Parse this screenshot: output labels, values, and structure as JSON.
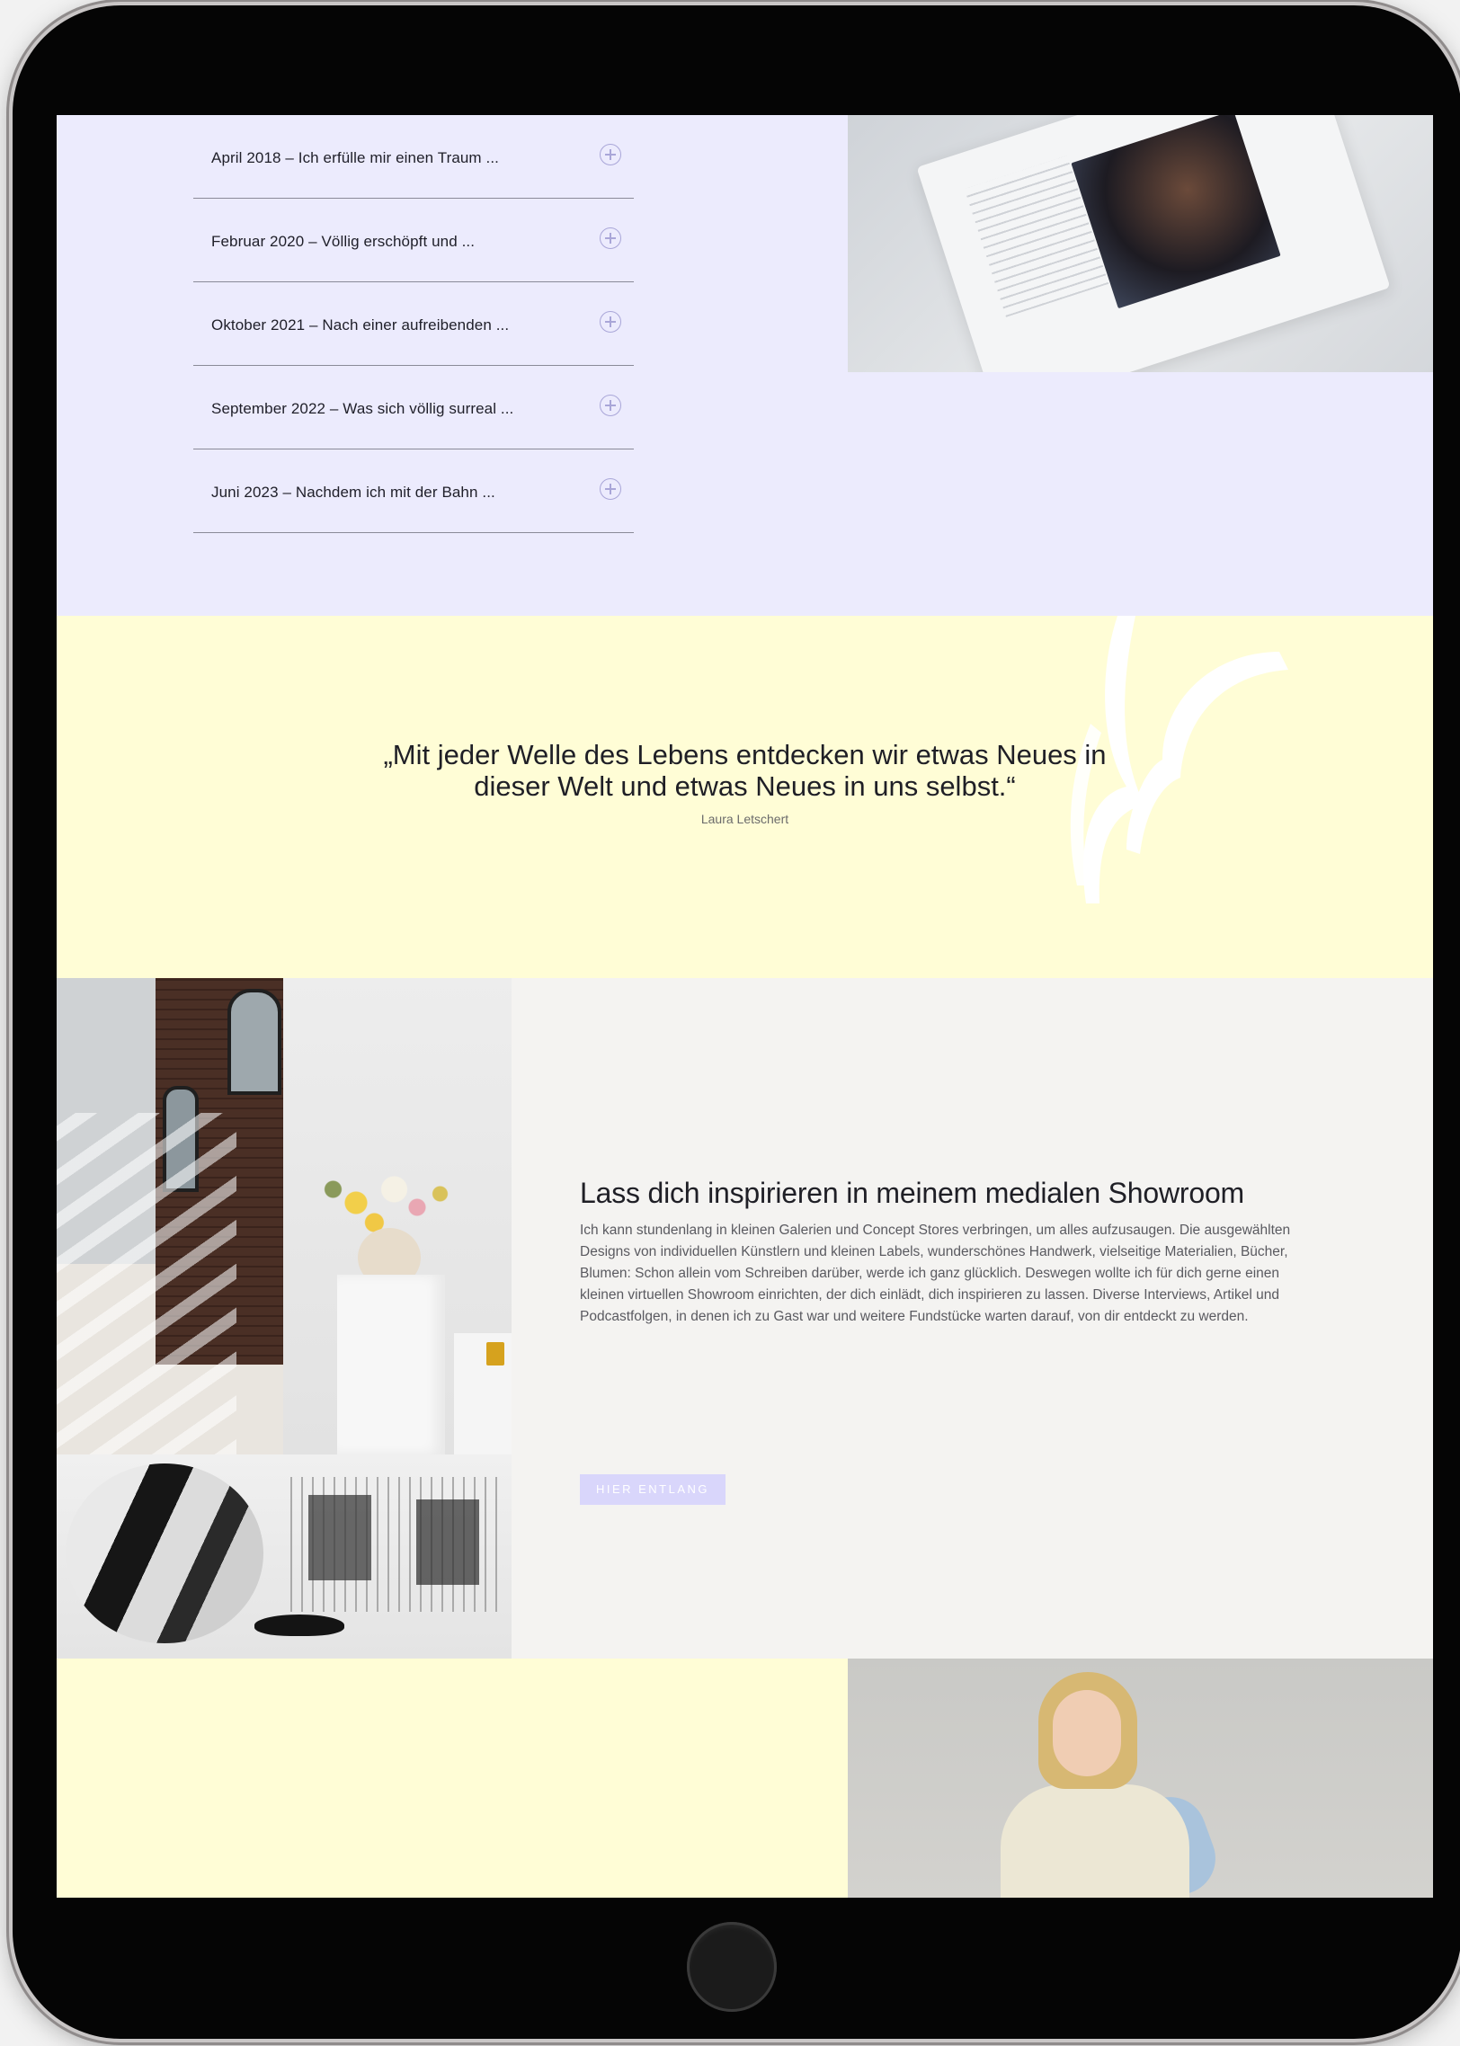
{
  "timeline": {
    "items": [
      {
        "label": "April 2018 – Ich erfülle mir einen Traum ..."
      },
      {
        "label": "Februar 2020 – Völlig erschöpft und ..."
      },
      {
        "label": "Oktober 2021 – Nach einer aufreibenden ..."
      },
      {
        "label": "September 2022 – Was sich völlig surreal ..."
      },
      {
        "label": "Juni 2023 – Nachdem ich mit der Bahn ..."
      }
    ],
    "expand_icon": "plus-circle-icon"
  },
  "quote": {
    "text_line1": "„Mit jeder Welle des Lebens entdecken wir etwas Neues in",
    "text_line2": "dieser Welt und etwas Neues in uns selbst.“",
    "author": "Laura Letschert"
  },
  "showroom": {
    "title": "Lass dich inspirieren in meinem medialen Showroom",
    "body": "Ich kann stundenlang in kleinen Galerien und Concept Stores verbringen, um alles aufzusaugen. Die ausgewählten Designs von individuellen Künstlern und kleinen Labels, wunderschönes Handwerk, vielseitige Materialien, Bücher, Blumen: Schon allein vom Schreiben darüber, werde ich ganz glücklich. Deswegen wollte ich für dich gerne einen kleinen virtuellen Showroom einrichten, der dich einlädt, dich inspirieren zu lassen. Diverse Interviews, Artikel und Podcastfolgen, in denen ich zu Gast war und weitere Fundstücke warten darauf, von dir entdeckt zu werden.",
    "button_label": "HIER ENTLANG"
  },
  "colors": {
    "lavender": "#ecebfd",
    "cream": "#fffdd6",
    "offwhite": "#f4f3f1",
    "button": "#d9d6fb"
  }
}
